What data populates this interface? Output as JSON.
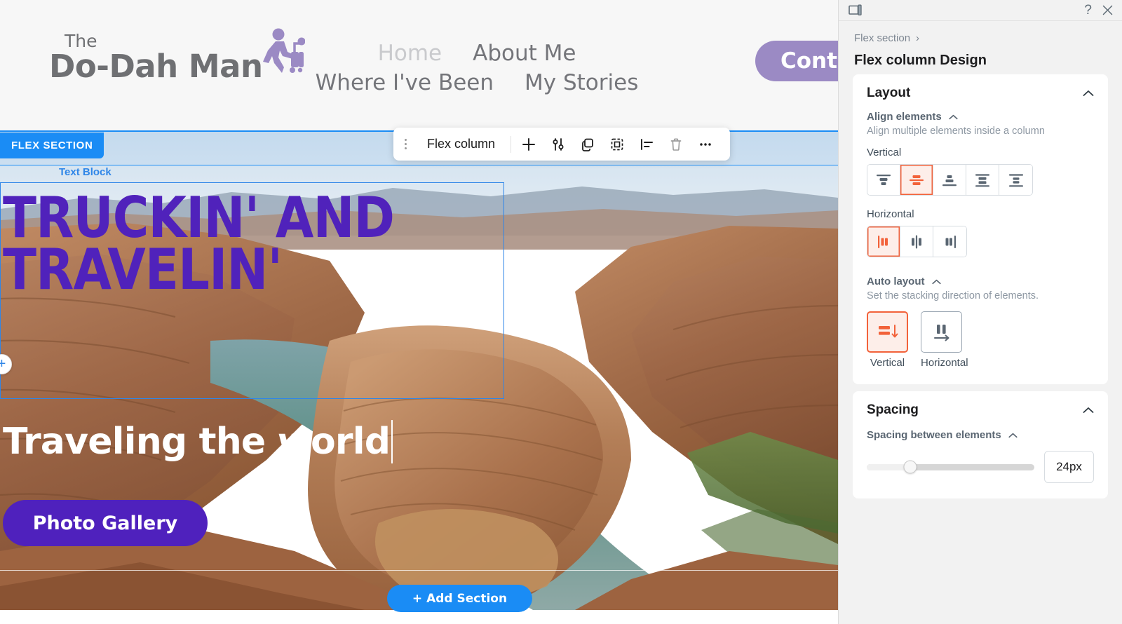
{
  "site": {
    "logo": {
      "the": "The",
      "name": "Do-Dah Man",
      "icon": "traveler-with-suitcase-icon"
    },
    "nav": [
      {
        "label": "Home",
        "active": true
      },
      {
        "label": "About Me",
        "active": false
      },
      {
        "label": "Where I've Been",
        "active": false
      },
      {
        "label": "My Stories",
        "active": false
      }
    ],
    "contact_button": "Contact",
    "hero": {
      "title_line1": "Truckin' and",
      "title_line2": "Travelin'",
      "subtitle": "Traveling the world",
      "cta": "Photo Gallery"
    },
    "colors": {
      "header_bg": "#f7f7f7",
      "logo_gray": "#6f7073",
      "nav_gray": "#74757a",
      "nav_active": "#c9cacd",
      "contact_purple": "#9b8ac4",
      "hero_purple": "#5022bb",
      "cta_purple": "#4f21bd"
    }
  },
  "editor": {
    "section_badge": "FLEX SECTION",
    "block_label": "Text Block",
    "add_section_button": "+ Add Section",
    "plus_handle": "+",
    "toolbar": {
      "grip": "drag-handle-icon",
      "element_name": "Flex column",
      "buttons": [
        {
          "name": "add-element-button",
          "icon": "plus-icon"
        },
        {
          "name": "settings-button",
          "icon": "sliders-icon"
        },
        {
          "name": "duplicate-button",
          "icon": "copy-icon"
        },
        {
          "name": "select-parent-button",
          "icon": "marquee-icon"
        },
        {
          "name": "align-button",
          "icon": "align-left-icon"
        },
        {
          "name": "delete-button",
          "icon": "trash-icon"
        },
        {
          "name": "more-options-button",
          "icon": "ellipsis-icon"
        }
      ]
    },
    "colors": {
      "editor_blue": "#1a8cf5",
      "selection_blue": "#2f86e8"
    }
  },
  "panel": {
    "topbar": {
      "panel_toggle_icon": "panel-layout-icon",
      "help_label": "?",
      "close_label": "✕"
    },
    "breadcrumb": {
      "parent": "Flex section",
      "separator": "›"
    },
    "title": "Flex column Design",
    "layout_card": {
      "title": "Layout",
      "collapse_icon": "chevron-up-icon",
      "align": {
        "title": "Align elements",
        "description": "Align multiple elements inside a column",
        "vertical_label": "Vertical",
        "vertical_options": [
          {
            "name": "align-top",
            "selected": false
          },
          {
            "name": "align-middle",
            "selected": true
          },
          {
            "name": "align-bottom",
            "selected": false
          },
          {
            "name": "space-between",
            "selected": false
          },
          {
            "name": "space-around",
            "selected": false
          }
        ],
        "horizontal_label": "Horizontal",
        "horizontal_options": [
          {
            "name": "align-left",
            "selected": true
          },
          {
            "name": "align-center",
            "selected": false
          },
          {
            "name": "align-right",
            "selected": false
          }
        ]
      },
      "auto_layout": {
        "title": "Auto layout",
        "description": "Set the stacking direction of elements.",
        "options": [
          {
            "label": "Vertical",
            "name": "stack-vertical",
            "selected": true
          },
          {
            "label": "Horizontal",
            "name": "stack-horizontal",
            "selected": false
          }
        ]
      }
    },
    "spacing_card": {
      "title": "Spacing",
      "collapse_icon": "chevron-up-icon",
      "between_elements": {
        "title": "Spacing between elements",
        "value": "24px",
        "slider_percent": 26
      }
    },
    "colors": {
      "panel_bg": "#f2f2f2",
      "accent_orange": "#f2623a",
      "accent_orange_bg": "#fdeee9",
      "icon_slate": "#5a6672"
    }
  }
}
